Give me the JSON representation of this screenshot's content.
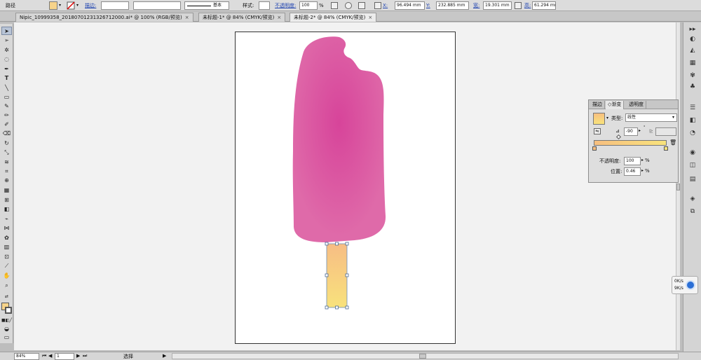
{
  "control_bar": {
    "object_type": "路径",
    "stroke_label": "描边:",
    "stroke_profile": "基本",
    "style_label": "样式:",
    "opacity_label": "不透明度:",
    "opacity_value": "100",
    "opacity_unit": "%",
    "x_label": "X:",
    "x_value": "96.494 mm",
    "y_label": "Y:",
    "y_value": "232.885 mm",
    "w_label": "宽:",
    "w_value": "19.301 mm",
    "h_label": "高:",
    "h_value": "61.294 mm",
    "fill_color": "#f6d38a"
  },
  "tabs": [
    {
      "label": "Nipic_10999358_20180701231326712000.ai* @ 100% (RGB/预览)",
      "close": "×"
    },
    {
      "label": "未标题-1* @ 84% (CMYK/预览)",
      "close": "×"
    },
    {
      "label": "未标题-2* @ 84% (CMYK/预览)",
      "close": "×"
    }
  ],
  "gradient_panel": {
    "tabs": [
      "描边",
      "◇渐变",
      "透明度"
    ],
    "type_label": "类型:",
    "type_value": "线性",
    "angle_value": "-90",
    "opacity_label": "不透明度:",
    "opacity_value": "100",
    "opacity_unit": "%",
    "position_label": "位置:",
    "position_value": "0.46",
    "position_unit": "%",
    "start_color": "#f7bf80",
    "end_color": "#f8e37c"
  },
  "status_bar": {
    "zoom": "84%",
    "page": "1",
    "tool": "选择"
  },
  "net_widget": {
    "up": "0K/s",
    "down": "9K/s"
  },
  "artwork": {
    "popsicle_color": "#d7449a",
    "stick_top_color": "#f7bd84",
    "stick_bottom_color": "#f8e27c"
  }
}
